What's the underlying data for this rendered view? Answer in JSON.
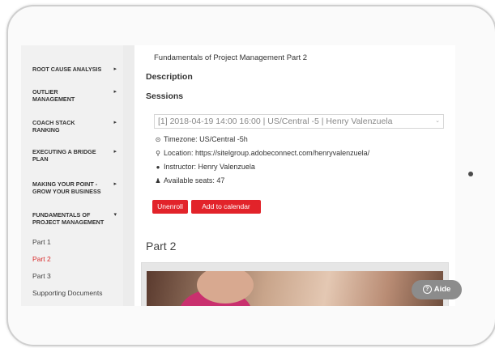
{
  "sidebar": {
    "items": [
      {
        "label": "ROOT CAUSE ANALYSIS",
        "arrow": "▸"
      },
      {
        "label": "OUTLIER MANAGEMENT",
        "arrow": "▸"
      },
      {
        "label": "COACH STACK RANKING",
        "arrow": "▸"
      },
      {
        "label": "EXECUTING A BRIDGE PLAN",
        "arrow": "▸"
      },
      {
        "label": "MAKING YOUR POINT - GROW YOUR BUSINESS",
        "arrow": "▸"
      },
      {
        "label": "FUNDAMENTALS OF PROJECT MANAGEMENT",
        "arrow": "▾"
      }
    ],
    "subitems": [
      "Part 1",
      "Part 2",
      "Part 3",
      "Supporting Documents"
    ],
    "active_subitem": "Part 2"
  },
  "main": {
    "top_title": "Fundamentals of Project Management Part 2",
    "description_heading": "Description",
    "sessions_heading": "Sessions",
    "session_selected": "[1] 2018-04-19 14:00 16:00 | US/Central -5 | Henry Valenzuela",
    "timezone": "Timezone: US/Central -5h",
    "location": "Location: https://sitelgroup.adobeconnect.com/henryvalenzuela/",
    "instructor": "Instructor: Henry Valenzuela",
    "seats": "Available seats: 47",
    "unenroll_label": "Unenroll",
    "calendar_label": "Add to calendar",
    "part_heading": "Part 2"
  },
  "help": {
    "label": "Aide",
    "icon": "?"
  },
  "colors": {
    "accent": "#e2232a",
    "active_link": "#d92b2b",
    "help_bg": "#8c8c8c"
  }
}
